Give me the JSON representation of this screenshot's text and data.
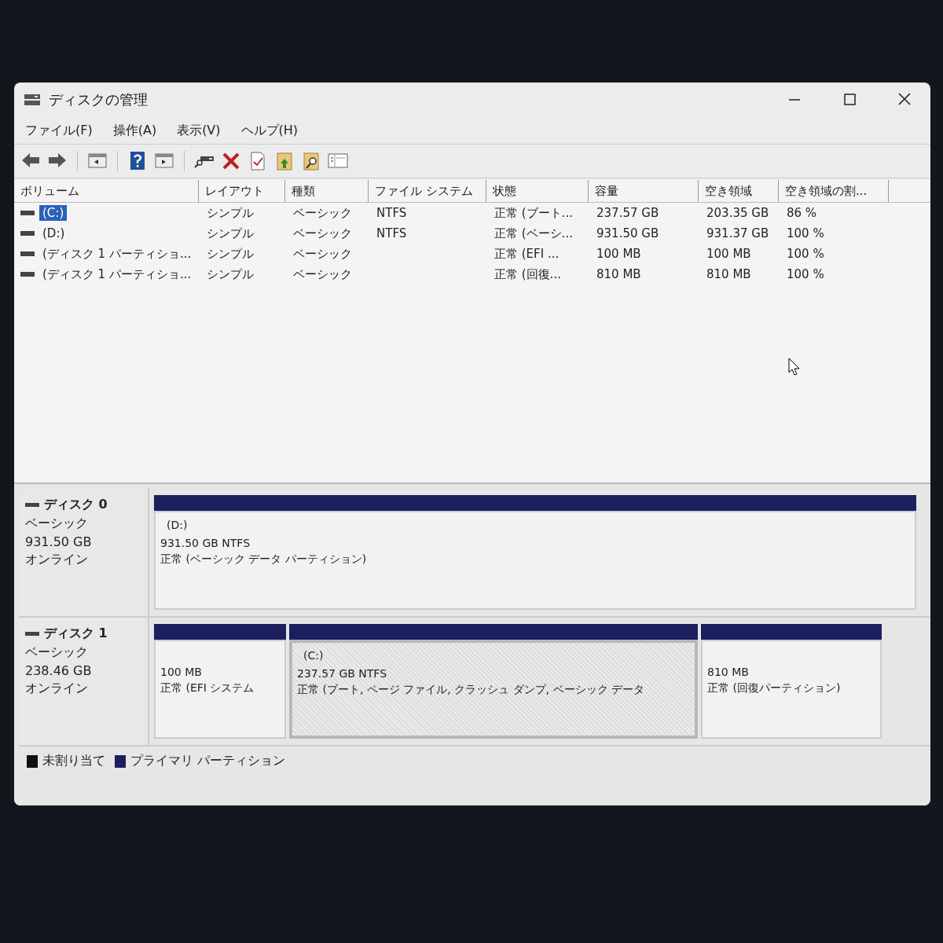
{
  "window": {
    "title": "ディスクの管理"
  },
  "menu": [
    "ファイル(F)",
    "操作(A)",
    "表示(V)",
    "ヘルプ(H)"
  ],
  "toolbar": [
    {
      "kind": "back"
    },
    {
      "kind": "forward"
    },
    {
      "kind": "sep"
    },
    {
      "kind": "panel-left"
    },
    {
      "kind": "sep"
    },
    {
      "kind": "help"
    },
    {
      "kind": "panel-right"
    },
    {
      "kind": "sep"
    },
    {
      "kind": "drive"
    },
    {
      "kind": "delete"
    },
    {
      "kind": "check"
    },
    {
      "kind": "folder-up"
    },
    {
      "kind": "folder-search"
    },
    {
      "kind": "list"
    }
  ],
  "table": {
    "columns": [
      "ボリューム",
      "レイアウト",
      "種類",
      "ファイル システム",
      "状態",
      "容量",
      "空き領域",
      "空き領域の割..."
    ],
    "rows": [
      {
        "selected": true,
        "cells": [
          "(C:)",
          "シンプル",
          "ベーシック",
          "NTFS",
          "正常 (ブート...",
          "237.57 GB",
          "203.35 GB",
          "86 %"
        ]
      },
      {
        "selected": false,
        "cells": [
          "(D:)",
          "シンプル",
          "ベーシック",
          "NTFS",
          "正常 (ベーシ...",
          "931.50 GB",
          "931.37 GB",
          "100 %"
        ]
      },
      {
        "selected": false,
        "cells": [
          "(ディスク 1 パーティショ...",
          "シンプル",
          "ベーシック",
          "",
          "正常 (EFI ...",
          "100 MB",
          "100 MB",
          "100 %"
        ]
      },
      {
        "selected": false,
        "cells": [
          "(ディスク 1 パーティショ...",
          "シンプル",
          "ベーシック",
          "",
          "正常 (回復...",
          "810 MB",
          "810 MB",
          "100 %"
        ]
      }
    ]
  },
  "disks": [
    {
      "name": "ディスク 0",
      "type": "ベーシック",
      "size": "931.50 GB",
      "status": "オンライン",
      "partitions": [
        {
          "selected": false,
          "title": "(D:)",
          "size": "931.50 GB NTFS",
          "status": "正常 (ベーシック データ パーティション)"
        }
      ]
    },
    {
      "name": "ディスク 1",
      "type": "ベーシック",
      "size": "238.46 GB",
      "status": "オンライン",
      "partitions": [
        {
          "selected": false,
          "size": "100 MB",
          "status": "正常 (EFI システム"
        },
        {
          "selected": true,
          "title": "(C:)",
          "size": "237.57 GB NTFS",
          "status": "正常 (ブート, ページ ファイル, クラッシュ ダンプ, ベーシック データ"
        },
        {
          "selected": false,
          "size": "810 MB",
          "status": "正常 (回復パーティション)"
        }
      ]
    }
  ],
  "legend": [
    {
      "label": "未割り当て",
      "color": "#111111"
    },
    {
      "label": "プライマリ パーティション",
      "color": "#1c1f5e"
    }
  ]
}
